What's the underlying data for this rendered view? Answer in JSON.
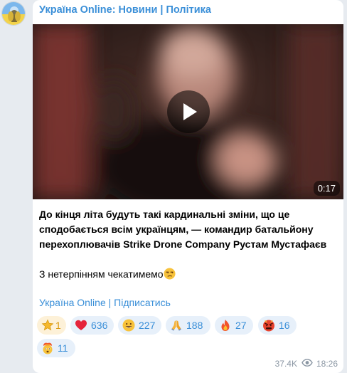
{
  "channel": {
    "name": "Україна Online: Новини | Політика"
  },
  "video": {
    "duration": "0:17"
  },
  "post": {
    "headline": "До кінця літа будуть такі кардинальні зміни, що це сподобається всім українцям, — командир батальйону перехоплювачів Strike Drone Company Рустам Мустафаєв",
    "closing": "З нетерпінням чекатимемо",
    "closing_emoji": "unamused-face-icon",
    "link": "Україна Online | Підписатись"
  },
  "reactions": [
    {
      "icon": "star-icon",
      "count": "1"
    },
    {
      "icon": "heart-icon",
      "count": "636"
    },
    {
      "icon": "grinning-face-icon",
      "count": "227"
    },
    {
      "icon": "folded-hands-icon",
      "count": "188"
    },
    {
      "icon": "fire-icon",
      "count": "27"
    },
    {
      "icon": "angry-face-icon",
      "count": "16"
    },
    {
      "icon": "exploding-head-icon",
      "count": "11"
    }
  ],
  "stats": {
    "views": "37.4K",
    "time": "18:26"
  },
  "colors": {
    "accent": "#3a8fd8",
    "background": "#e7ebf0",
    "reaction_bg": "#e7f0fa",
    "paid_reaction_bg": "#fdf1d8"
  }
}
